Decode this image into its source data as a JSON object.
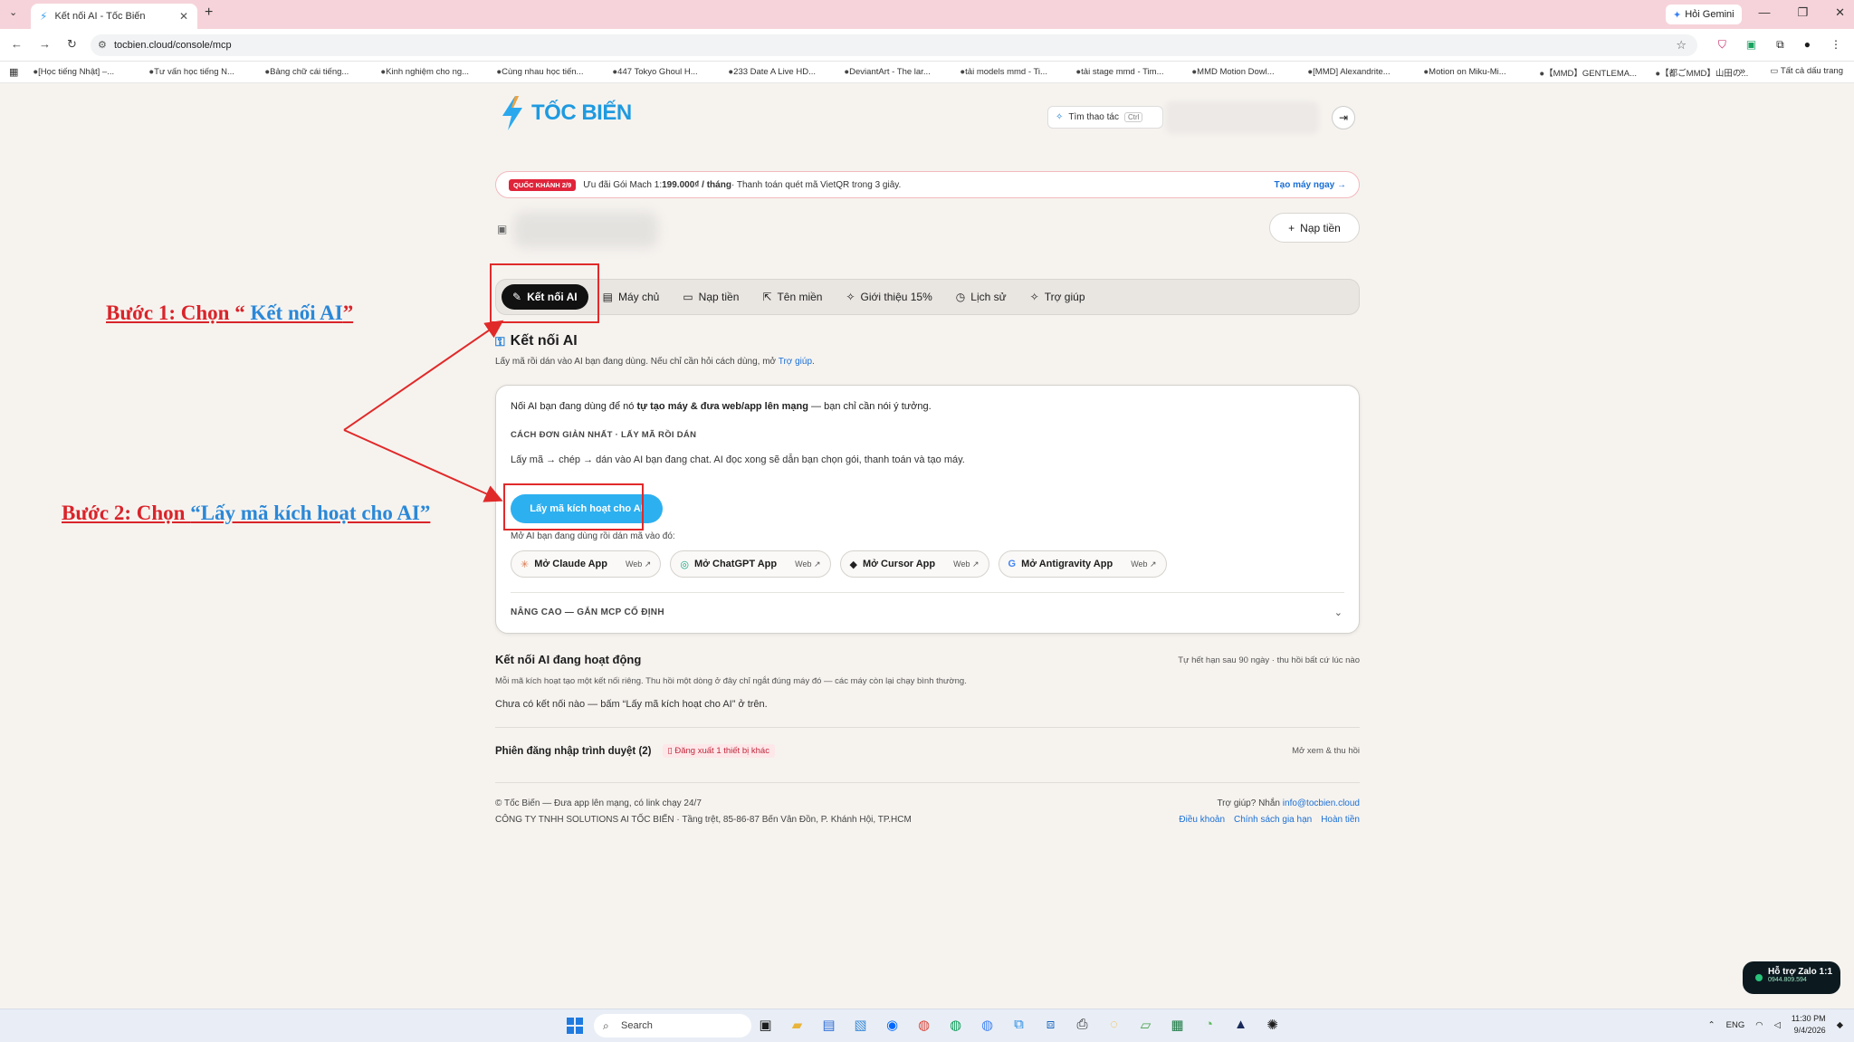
{
  "browser": {
    "tab_title": "Kết nối AI - Tốc Biến",
    "url": "tocbien.cloud/console/mcp",
    "gemini_label": "Hỏi Gemini",
    "bookmarks": [
      "[Học tiếng Nhật] –...",
      "Tư vấn học tiếng N...",
      "Bảng chữ cái tiếng...",
      "Kinh nghiệm cho ng...",
      "Cùng nhau học tiến...",
      "447 Tokyo Ghoul H...",
      "233 Date A Live HD...",
      "DeviantArt - The lar...",
      "tải models mmd - Ti...",
      "tải stage mmd - Tim...",
      "MMD Motion Dowl...",
      "[MMD] Alexandrite...",
      "Motion on Miku-Mi...",
      "【MMD】GENTLEMA...",
      "【都ごMMD】山田の..."
    ],
    "bookmarks_folder": "Tất cả dấu trang"
  },
  "header": {
    "brand": "TỐC BIẾN",
    "search_label": "Tìm thao tác",
    "search_kbd": "Ctrl"
  },
  "promo": {
    "badge": "QUỐC KHÁNH 2/9",
    "text_pre": "Ưu đãi Gói Mach 1: ",
    "price": "199.000₫ / tháng",
    "text_post": " · Thanh toán quét mã VietQR trong 3 giây.",
    "cta": "Tạo máy ngay →"
  },
  "topup_button": "Nạp tiền",
  "tabs": [
    {
      "label": "Kết nối AI",
      "icon": "✎"
    },
    {
      "label": "Máy chủ",
      "icon": "▤"
    },
    {
      "label": "Nạp tiền",
      "icon": "▭"
    },
    {
      "label": "Tên miền",
      "icon": "⇱"
    },
    {
      "label": "Giới thiệu 15%",
      "icon": "✧"
    },
    {
      "label": "Lịch sử",
      "icon": "◷"
    },
    {
      "label": "Trợ giúp",
      "icon": "✧"
    }
  ],
  "section": {
    "title": "Kết nối AI",
    "subtitle_pre": "Lấy mã rồi dán vào AI bạn đang dùng. Nếu chỉ cần hỏi cách dùng, mở ",
    "subtitle_link": "Trợ giúp",
    "subtitle_post": "."
  },
  "card": {
    "intro_pre": "Nối AI bạn đang dùng để nó ",
    "intro_bold": "tự tạo máy & đưa web/app lên mạng",
    "intro_post": " — bạn chỉ cần nói ý tưởng.",
    "caps": "CÁCH ĐƠN GIẢN NHẤT · LẤY MÃ RỒI DÁN",
    "desc": "Lấy mã → chép → dán vào AI bạn đang chat. AI đọc xong sẽ dẫn bạn chọn gói, thanh toán và tạo máy.",
    "get_button": "Lấy mã kích hoạt cho AI",
    "open_label": "Mở AI bạn đang dùng rồi dán mã vào đó:",
    "apps": [
      {
        "label": "Mở Claude App",
        "web": "Web ↗",
        "icon": "✳",
        "color": "#d9774a"
      },
      {
        "label": "Mở ChatGPT App",
        "web": "Web ↗",
        "icon": "◎",
        "color": "#10a37f"
      },
      {
        "label": "Mở Cursor App",
        "web": "Web ↗",
        "icon": "◆",
        "color": "#222222"
      },
      {
        "label": "Mở Antigravity App",
        "web": "Web ↗",
        "icon": "G",
        "color": "#4285f4"
      }
    ],
    "advanced": "NÂNG CAO — GẮN MCP CỐ ĐỊNH"
  },
  "active": {
    "title": "Kết nối AI đang hoạt động",
    "right": "Tự hết hạn sau 90 ngày · thu hồi bất cứ lúc nào",
    "sub": "Mỗi mã kích hoạt tạo một kết nối riêng. Thu hồi một dòng ở đây chỉ ngắt đúng máy đó — các máy còn lại chạy bình thường.",
    "empty": "Chưa có kết nối nào — bấm “Lấy mã kích hoạt cho AI” ở trên."
  },
  "sessions": {
    "title": "Phiên đăng nhập trình duyệt (2)",
    "chip": "Đăng xuất 1 thiết bị khác",
    "right": "Mở xem & thu hồi"
  },
  "footer": {
    "line1": "© Tốc Biến — Đưa app lên mạng, có link chạy 24/7",
    "line2": "CÔNG TY TNHH SOLUTIONS AI TỐC BIẾN · Tầng trệt, 85-86-87 Bến Vân Đồn, P. Khánh Hội, TP.HCM",
    "help_pre": "Trợ giúp? Nhắn ",
    "email": "info@tocbien.cloud",
    "links": [
      "Điều khoản",
      "Chính sách gia hạn",
      "Hoàn tiền"
    ]
  },
  "annotations": {
    "step1_pre": "Bước 1: Chọn “ ",
    "step1_hl": "Kết nối AI",
    "step1_post": "”",
    "step2_pre": "Bước 2: Chọn ",
    "step2_hl": "“Lấy mã kích hoạt cho AI”"
  },
  "zalo": {
    "title": "Hỗ trợ Zalo 1:1",
    "phone": "0944.809.594"
  },
  "taskbar": {
    "search": "Search",
    "lang": "ENG",
    "time": "11:30 PM",
    "date": "9/4/2026"
  }
}
